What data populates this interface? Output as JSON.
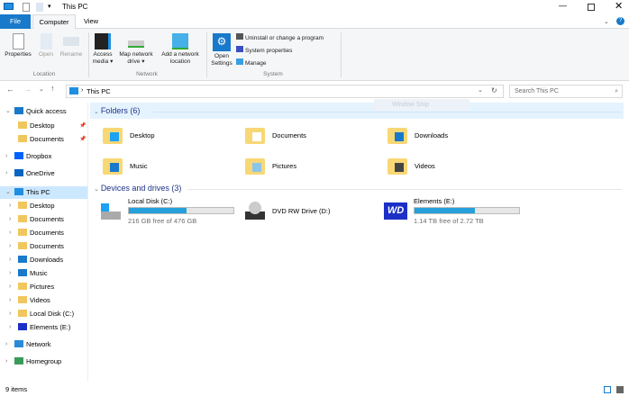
{
  "window": {
    "title": "This PC"
  },
  "ribbon_tabs": [
    "File",
    "Computer",
    "View"
  ],
  "ribbon": {
    "location": {
      "label": "Location",
      "buttons": [
        "Properties",
        "Open",
        "Rename"
      ]
    },
    "network": {
      "label": "Network",
      "buttons": [
        "Access media ▾",
        "Map network drive ▾",
        "Add a network location"
      ]
    },
    "system": {
      "label": "System",
      "open_settings": "Open Settings",
      "items": [
        "Uninstall or change a program",
        "System properties",
        "Manage"
      ]
    }
  },
  "address": {
    "path": "This PC",
    "search_placeholder": "Search This PC",
    "overlay": "Window Snip"
  },
  "sidebar": {
    "items": [
      {
        "label": "Quick access",
        "level": 0
      },
      {
        "label": "Desktop",
        "level": 1
      },
      {
        "label": "Documents",
        "level": 1
      },
      {
        "label": "Dropbox",
        "level": 0
      },
      {
        "label": "OneDrive",
        "level": 0
      },
      {
        "label": "This PC",
        "level": 0,
        "selected": true
      },
      {
        "label": "Desktop",
        "level": 1
      },
      {
        "label": "Documents",
        "level": 1
      },
      {
        "label": "Documents",
        "level": 1
      },
      {
        "label": "Documents",
        "level": 1
      },
      {
        "label": "Downloads",
        "level": 1
      },
      {
        "label": "Music",
        "level": 1
      },
      {
        "label": "Pictures",
        "level": 1
      },
      {
        "label": "Videos",
        "level": 1
      },
      {
        "label": "Local Disk (C:)",
        "level": 1
      },
      {
        "label": "Elements (E:)",
        "level": 1
      },
      {
        "label": "Network",
        "level": 0
      },
      {
        "label": "Homegroup",
        "level": 0
      }
    ]
  },
  "folders": {
    "header": "Folders (6)",
    "items": [
      "Desktop",
      "Documents",
      "Downloads",
      "Music",
      "Pictures",
      "Videos"
    ]
  },
  "drives": {
    "header": "Devices and drives (3)",
    "items": [
      {
        "name": "Local Disk (C:)",
        "free": "216 GB free of 476 GB",
        "used_fraction": 0.55
      },
      {
        "name": "DVD RW Drive (D:)"
      },
      {
        "name": "Elements (E:)",
        "free": "1.14 TB free of 2.72 TB",
        "used_fraction": 0.58
      }
    ]
  },
  "status": {
    "items": "9 items"
  },
  "colors": {
    "accent": "#1979ca",
    "bar": "#26a0da",
    "header": "#1e3287",
    "selected": "#cce8ff"
  }
}
